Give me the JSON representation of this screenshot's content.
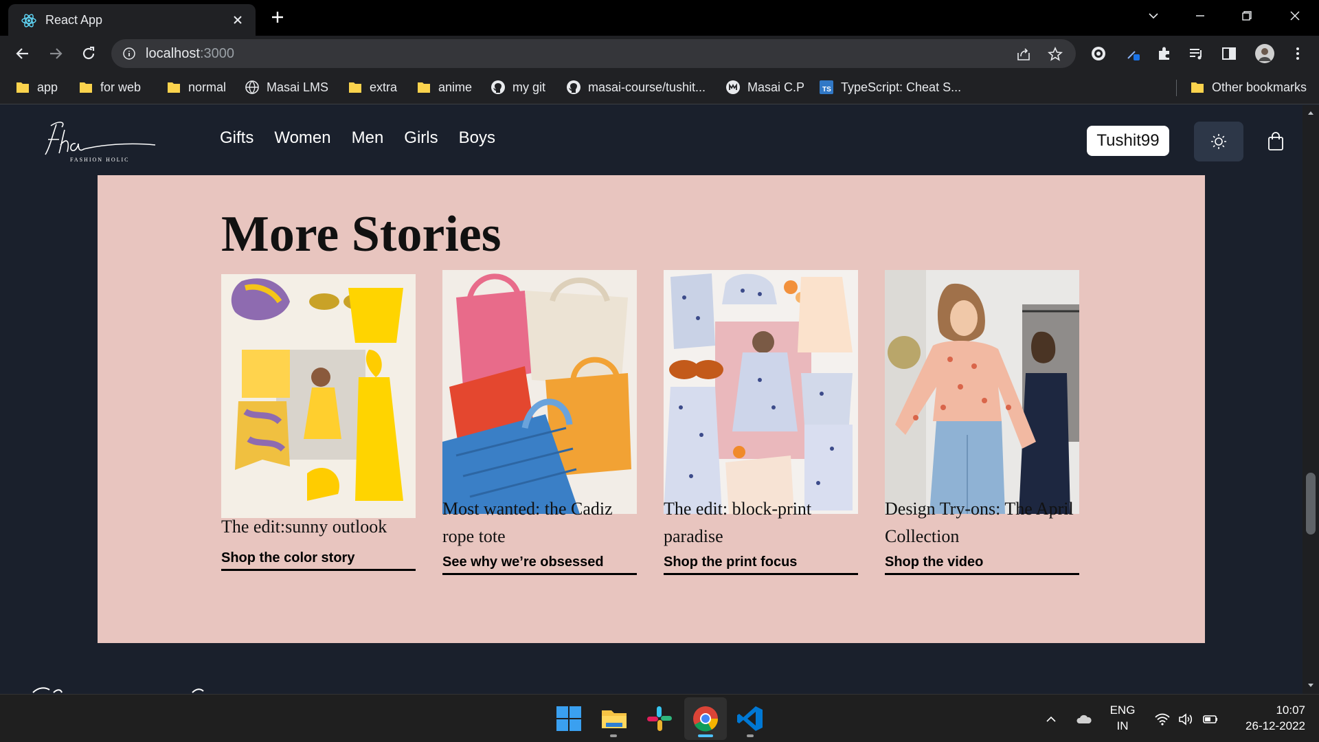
{
  "browser": {
    "tab_title": "React App",
    "url_host": "localhost",
    "url_port": ":3000",
    "bookmarks": [
      {
        "label": "app",
        "icon": "folder-icon"
      },
      {
        "label": "for web",
        "icon": "folder-icon"
      },
      {
        "label": "normal",
        "icon": "folder-icon"
      },
      {
        "label": "Masai LMS",
        "icon": "globe-icon"
      },
      {
        "label": "extra",
        "icon": "folder-icon"
      },
      {
        "label": "anime",
        "icon": "folder-icon"
      },
      {
        "label": "my git",
        "icon": "github-icon"
      },
      {
        "label": "masai-course/tushit...",
        "icon": "github-icon"
      },
      {
        "label": "Masai C.P",
        "icon": "masai-icon"
      },
      {
        "label": "TypeScript: Cheat S...",
        "icon": "typescript-icon"
      }
    ],
    "other_bookmarks": "Other bookmarks"
  },
  "site": {
    "logo_text": "Fha",
    "logo_sub": "FASHION HOLIC",
    "nav": [
      "Gifts",
      "Women",
      "Men",
      "Girls",
      "Boys"
    ],
    "username": "Tushit99"
  },
  "stories": {
    "title": "More Stories",
    "cards": [
      {
        "title": "The edit:sunny outlook",
        "link": "Shop the color story",
        "image": "yellow-purple-outfit-collage"
      },
      {
        "title": "Most wanted: the Cadiz rope tote",
        "link": "See why we’re obsessed",
        "image": "crochet-rope-totes"
      },
      {
        "title": "The edit: block-print paradise",
        "link": "Shop the print focus",
        "image": "block-print-outfit-collage"
      },
      {
        "title": "Design Try-ons: The April Collection",
        "link": "Shop the video",
        "image": "women-in-studio-photo"
      }
    ]
  },
  "taskbar": {
    "lang_top": "ENG",
    "lang_bottom": "IN",
    "time": "10:07",
    "date": "26-12-2022"
  },
  "colors": {
    "page_bg": "#1a202c",
    "stories_bg": "#e8c5bf",
    "chrome_bg": "#202124"
  }
}
